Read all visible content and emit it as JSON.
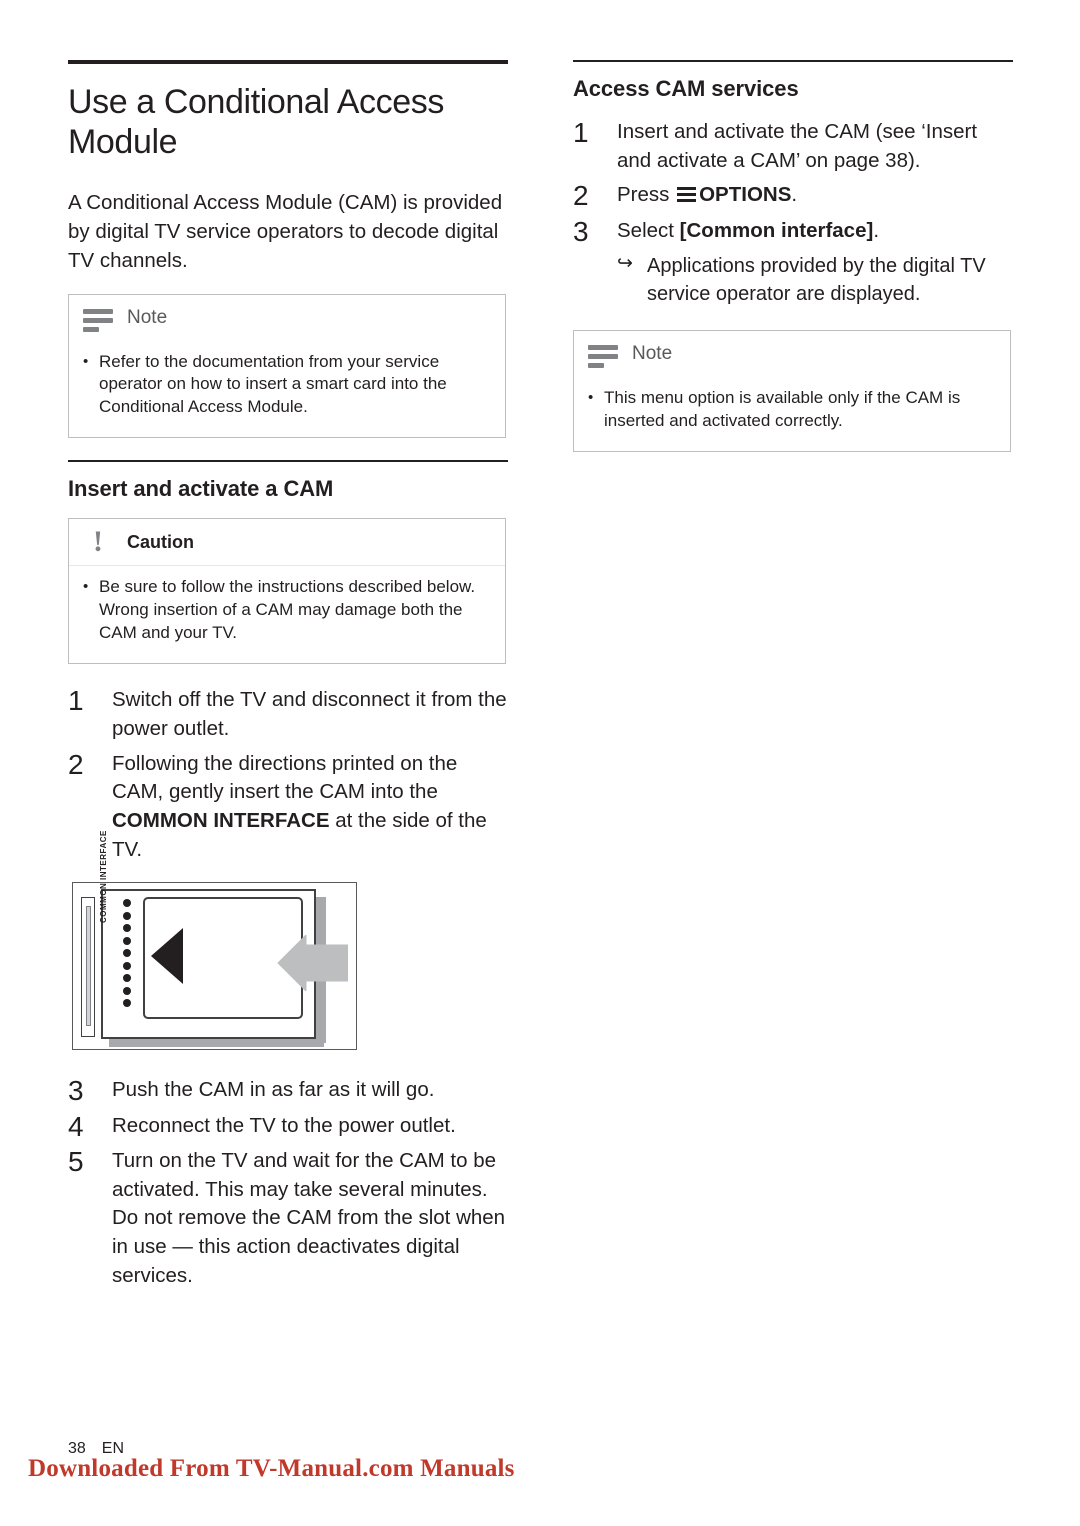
{
  "left_column": {
    "title": "Use a Conditional Access Module",
    "intro": "A Conditional Access Module (CAM) is provided by digital TV service operators to decode digital TV channels.",
    "note": {
      "label": "Note",
      "items": [
        "Refer to the documentation from your service operator on how to insert a smart card into the Conditional Access Module."
      ]
    },
    "section_title": "Insert and activate a CAM",
    "caution": {
      "label": "Caution",
      "items": [
        "Be sure to follow the instructions described below. Wrong insertion of a CAM may damage both the CAM and your TV."
      ]
    },
    "steps": [
      {
        "num": "1",
        "text": "Switch off the TV and disconnect it from the power outlet."
      },
      {
        "num": "2",
        "text_before": "Following the directions printed on the CAM, gently insert the CAM into the ",
        "bold": "COMMON INTERFACE",
        "text_after": " at the side of the TV."
      }
    ],
    "illustration": {
      "label": "COMMON INTERFACE"
    },
    "steps_after": [
      {
        "num": "3",
        "text": "Push the CAM in as far as it will go."
      },
      {
        "num": "4",
        "text": "Reconnect the TV to the power outlet."
      },
      {
        "num": "5",
        "text": "Turn on the TV and wait for the CAM to be activated. This may take several minutes. Do not remove the CAM from the slot when in use — this action deactivates digital services."
      }
    ]
  },
  "right_column": {
    "title": "Access CAM services",
    "steps": [
      {
        "num": "1",
        "text": "Insert and activate the CAM (see ‘Insert and activate a CAM’ on page 38)."
      },
      {
        "num": "2",
        "text_before": "Press ",
        "icon": "options-icon",
        "bold": "OPTIONS",
        "text_after": "."
      },
      {
        "num": "3",
        "text_before": "Select ",
        "bold": "[Common interface]",
        "text_after": "."
      }
    ],
    "substep": "Applications provided by the digital TV service operator are displayed.",
    "note": {
      "label": "Note",
      "items": [
        "This menu option is available only if the CAM is inserted and activated correctly."
      ]
    }
  },
  "footer": {
    "page_number": "38",
    "language": "EN",
    "watermark": "Downloaded From TV-Manual.com Manuals"
  }
}
